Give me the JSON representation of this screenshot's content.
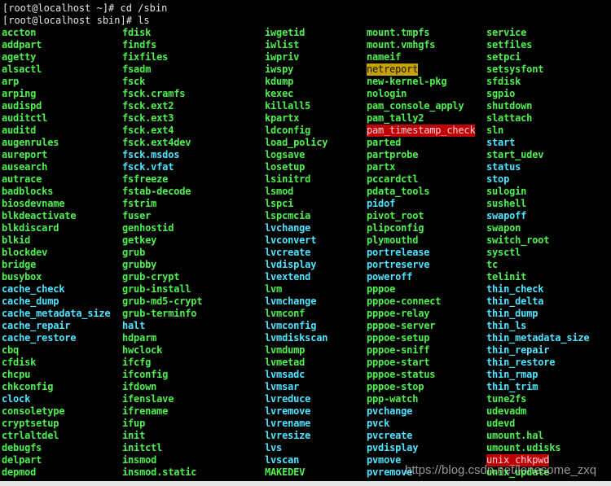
{
  "terminal": {
    "cut_line": "",
    "prompt_lines": [
      "[root@localhost ~]# cd /sbin",
      "[root@localhost sbin]# ls"
    ],
    "colors": {
      "exec": "#4ff04f",
      "link": "#4fe3ff",
      "warn_bg": "#c8a000",
      "danger_bg": "#c00000",
      "background": "#000000"
    },
    "columns": [
      [
        [
          "accton",
          "exec"
        ],
        [
          "addpart",
          "exec"
        ],
        [
          "agetty",
          "exec"
        ],
        [
          "alsactl",
          "exec"
        ],
        [
          "arp",
          "exec"
        ],
        [
          "arping",
          "exec"
        ],
        [
          "audispd",
          "exec"
        ],
        [
          "auditctl",
          "exec"
        ],
        [
          "auditd",
          "exec"
        ],
        [
          "augenrules",
          "exec"
        ],
        [
          "aureport",
          "exec"
        ],
        [
          "ausearch",
          "exec"
        ],
        [
          "autrace",
          "exec"
        ],
        [
          "badblocks",
          "exec"
        ],
        [
          "biosdevname",
          "exec"
        ],
        [
          "blkdeactivate",
          "exec"
        ],
        [
          "blkdiscard",
          "exec"
        ],
        [
          "blkid",
          "exec"
        ],
        [
          "blockdev",
          "exec"
        ],
        [
          "bridge",
          "exec"
        ],
        [
          "busybox",
          "exec"
        ],
        [
          "cache_check",
          "link"
        ],
        [
          "cache_dump",
          "link"
        ],
        [
          "cache_metadata_size",
          "link"
        ],
        [
          "cache_repair",
          "link"
        ],
        [
          "cache_restore",
          "link"
        ],
        [
          "cbq",
          "exec"
        ],
        [
          "cfdisk",
          "exec"
        ],
        [
          "chcpu",
          "exec"
        ],
        [
          "chkconfig",
          "exec"
        ],
        [
          "clock",
          "link"
        ],
        [
          "consoletype",
          "exec"
        ],
        [
          "cryptsetup",
          "exec"
        ],
        [
          "ctrlaltdel",
          "exec"
        ],
        [
          "debugfs",
          "exec"
        ],
        [
          "delpart",
          "exec"
        ],
        [
          "depmod",
          "exec"
        ]
      ],
      [
        [
          "fdisk",
          "exec"
        ],
        [
          "findfs",
          "exec"
        ],
        [
          "fixfiles",
          "exec"
        ],
        [
          "fsadm",
          "exec"
        ],
        [
          "fsck",
          "exec"
        ],
        [
          "fsck.cramfs",
          "exec"
        ],
        [
          "fsck.ext2",
          "exec"
        ],
        [
          "fsck.ext3",
          "exec"
        ],
        [
          "fsck.ext4",
          "exec"
        ],
        [
          "fsck.ext4dev",
          "exec"
        ],
        [
          "fsck.msdos",
          "link"
        ],
        [
          "fsck.vfat",
          "link"
        ],
        [
          "fsfreeze",
          "exec"
        ],
        [
          "fstab-decode",
          "exec"
        ],
        [
          "fstrim",
          "exec"
        ],
        [
          "fuser",
          "exec"
        ],
        [
          "genhostid",
          "exec"
        ],
        [
          "getkey",
          "exec"
        ],
        [
          "grub",
          "exec"
        ],
        [
          "grubby",
          "exec"
        ],
        [
          "grub-crypt",
          "exec"
        ],
        [
          "grub-install",
          "exec"
        ],
        [
          "grub-md5-crypt",
          "exec"
        ],
        [
          "grub-terminfo",
          "exec"
        ],
        [
          "halt",
          "link"
        ],
        [
          "hdparm",
          "exec"
        ],
        [
          "hwclock",
          "exec"
        ],
        [
          "ifcfg",
          "exec"
        ],
        [
          "ifconfig",
          "exec"
        ],
        [
          "ifdown",
          "exec"
        ],
        [
          "ifenslave",
          "exec"
        ],
        [
          "ifrename",
          "exec"
        ],
        [
          "ifup",
          "exec"
        ],
        [
          "init",
          "exec"
        ],
        [
          "initctl",
          "exec"
        ],
        [
          "insmod",
          "exec"
        ],
        [
          "insmod.static",
          "exec"
        ]
      ],
      [
        [
          "iwgetid",
          "exec"
        ],
        [
          "iwlist",
          "exec"
        ],
        [
          "iwpriv",
          "exec"
        ],
        [
          "iwspy",
          "exec"
        ],
        [
          "kdump",
          "exec"
        ],
        [
          "kexec",
          "exec"
        ],
        [
          "killall5",
          "exec"
        ],
        [
          "kpartx",
          "exec"
        ],
        [
          "ldconfig",
          "exec"
        ],
        [
          "load_policy",
          "exec"
        ],
        [
          "logsave",
          "exec"
        ],
        [
          "losetup",
          "exec"
        ],
        [
          "lsinitrd",
          "exec"
        ],
        [
          "lsmod",
          "exec"
        ],
        [
          "lspci",
          "exec"
        ],
        [
          "lspcmcia",
          "exec"
        ],
        [
          "lvchange",
          "link"
        ],
        [
          "lvconvert",
          "link"
        ],
        [
          "lvcreate",
          "link"
        ],
        [
          "lvdisplay",
          "link"
        ],
        [
          "lvextend",
          "link"
        ],
        [
          "lvm",
          "exec"
        ],
        [
          "lvmchange",
          "link"
        ],
        [
          "lvmconf",
          "exec"
        ],
        [
          "lvmconfig",
          "link"
        ],
        [
          "lvmdiskscan",
          "link"
        ],
        [
          "lvmdump",
          "exec"
        ],
        [
          "lvmetad",
          "exec"
        ],
        [
          "lvmsadc",
          "link"
        ],
        [
          "lvmsar",
          "link"
        ],
        [
          "lvreduce",
          "link"
        ],
        [
          "lvremove",
          "link"
        ],
        [
          "lvrename",
          "link"
        ],
        [
          "lvresize",
          "link"
        ],
        [
          "lvs",
          "link"
        ],
        [
          "lvscan",
          "link"
        ],
        [
          "MAKEDEV",
          "exec"
        ]
      ],
      [
        [
          "mount.tmpfs",
          "exec"
        ],
        [
          "mount.vmhgfs",
          "exec"
        ],
        [
          "nameif",
          "exec"
        ],
        [
          "netreport",
          "warn"
        ],
        [
          "new-kernel-pkg",
          "exec"
        ],
        [
          "nologin",
          "exec"
        ],
        [
          "pam_console_apply",
          "exec"
        ],
        [
          "pam_tally2",
          "exec"
        ],
        [
          "pam_timestamp_check",
          "danger"
        ],
        [
          "parted",
          "exec"
        ],
        [
          "partprobe",
          "exec"
        ],
        [
          "partx",
          "exec"
        ],
        [
          "pccardctl",
          "exec"
        ],
        [
          "pdata_tools",
          "exec"
        ],
        [
          "pidof",
          "link"
        ],
        [
          "pivot_root",
          "exec"
        ],
        [
          "plipconfig",
          "exec"
        ],
        [
          "plymouthd",
          "exec"
        ],
        [
          "portrelease",
          "link"
        ],
        [
          "portreserve",
          "link"
        ],
        [
          "poweroff",
          "link"
        ],
        [
          "pppoe",
          "exec"
        ],
        [
          "pppoe-connect",
          "exec"
        ],
        [
          "pppoe-relay",
          "exec"
        ],
        [
          "pppoe-server",
          "exec"
        ],
        [
          "pppoe-setup",
          "exec"
        ],
        [
          "pppoe-sniff",
          "exec"
        ],
        [
          "pppoe-start",
          "exec"
        ],
        [
          "pppoe-status",
          "exec"
        ],
        [
          "pppoe-stop",
          "exec"
        ],
        [
          "ppp-watch",
          "exec"
        ],
        [
          "pvchange",
          "link"
        ],
        [
          "pvck",
          "link"
        ],
        [
          "pvcreate",
          "link"
        ],
        [
          "pvdisplay",
          "link"
        ],
        [
          "pvmove",
          "link"
        ],
        [
          "pvremove",
          "link"
        ]
      ],
      [
        [
          "service",
          "exec"
        ],
        [
          "setfiles",
          "exec"
        ],
        [
          "setpci",
          "exec"
        ],
        [
          "setsysfont",
          "exec"
        ],
        [
          "sfdisk",
          "exec"
        ],
        [
          "sgpio",
          "exec"
        ],
        [
          "shutdown",
          "exec"
        ],
        [
          "slattach",
          "exec"
        ],
        [
          "sln",
          "exec"
        ],
        [
          "start",
          "link"
        ],
        [
          "start_udev",
          "exec"
        ],
        [
          "status",
          "link"
        ],
        [
          "stop",
          "link"
        ],
        [
          "sulogin",
          "exec"
        ],
        [
          "sushell",
          "exec"
        ],
        [
          "swapoff",
          "link"
        ],
        [
          "swapon",
          "exec"
        ],
        [
          "switch_root",
          "exec"
        ],
        [
          "sysctl",
          "exec"
        ],
        [
          "tc",
          "exec"
        ],
        [
          "telinit",
          "exec"
        ],
        [
          "thin_check",
          "link"
        ],
        [
          "thin_delta",
          "link"
        ],
        [
          "thin_dump",
          "link"
        ],
        [
          "thin_ls",
          "link"
        ],
        [
          "thin_metadata_size",
          "link"
        ],
        [
          "thin_repair",
          "link"
        ],
        [
          "thin_restore",
          "link"
        ],
        [
          "thin_rmap",
          "link"
        ],
        [
          "thin_trim",
          "link"
        ],
        [
          "tune2fs",
          "exec"
        ],
        [
          "udevadm",
          "exec"
        ],
        [
          "udevd",
          "exec"
        ],
        [
          "umount.hal",
          "exec"
        ],
        [
          "umount.udisks",
          "exec"
        ],
        [
          "unix_chkpwd",
          "danger"
        ],
        [
          "unix_update",
          "exec"
        ]
      ]
    ]
  },
  "watermark": "https://blog.csdn.net/lonesome_zxq"
}
